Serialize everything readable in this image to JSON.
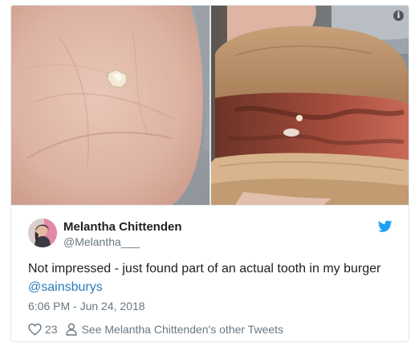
{
  "media": {
    "info_icon_glyph": "i"
  },
  "author": {
    "name": "Melantha Chittenden",
    "handle": "@Melantha___"
  },
  "tweet": {
    "text": "Not impressed - just found part of an actual tooth in my burger",
    "mention": "@sainsburys",
    "timestamp": "6:06 PM - Jun 24, 2018"
  },
  "actions": {
    "like_count": "23",
    "other_tweets_label": "See Melantha Chittenden's other Tweets"
  },
  "icons": {
    "media_info": "info-icon",
    "brand": "twitter-bird-icon",
    "like": "heart-icon",
    "profile": "person-icon"
  },
  "colors": {
    "text": "#1c2022",
    "secondary_text": "#697882",
    "link": "#2b7bb9",
    "twitter_blue": "#1da1f2",
    "border": "#e1e8ed"
  }
}
